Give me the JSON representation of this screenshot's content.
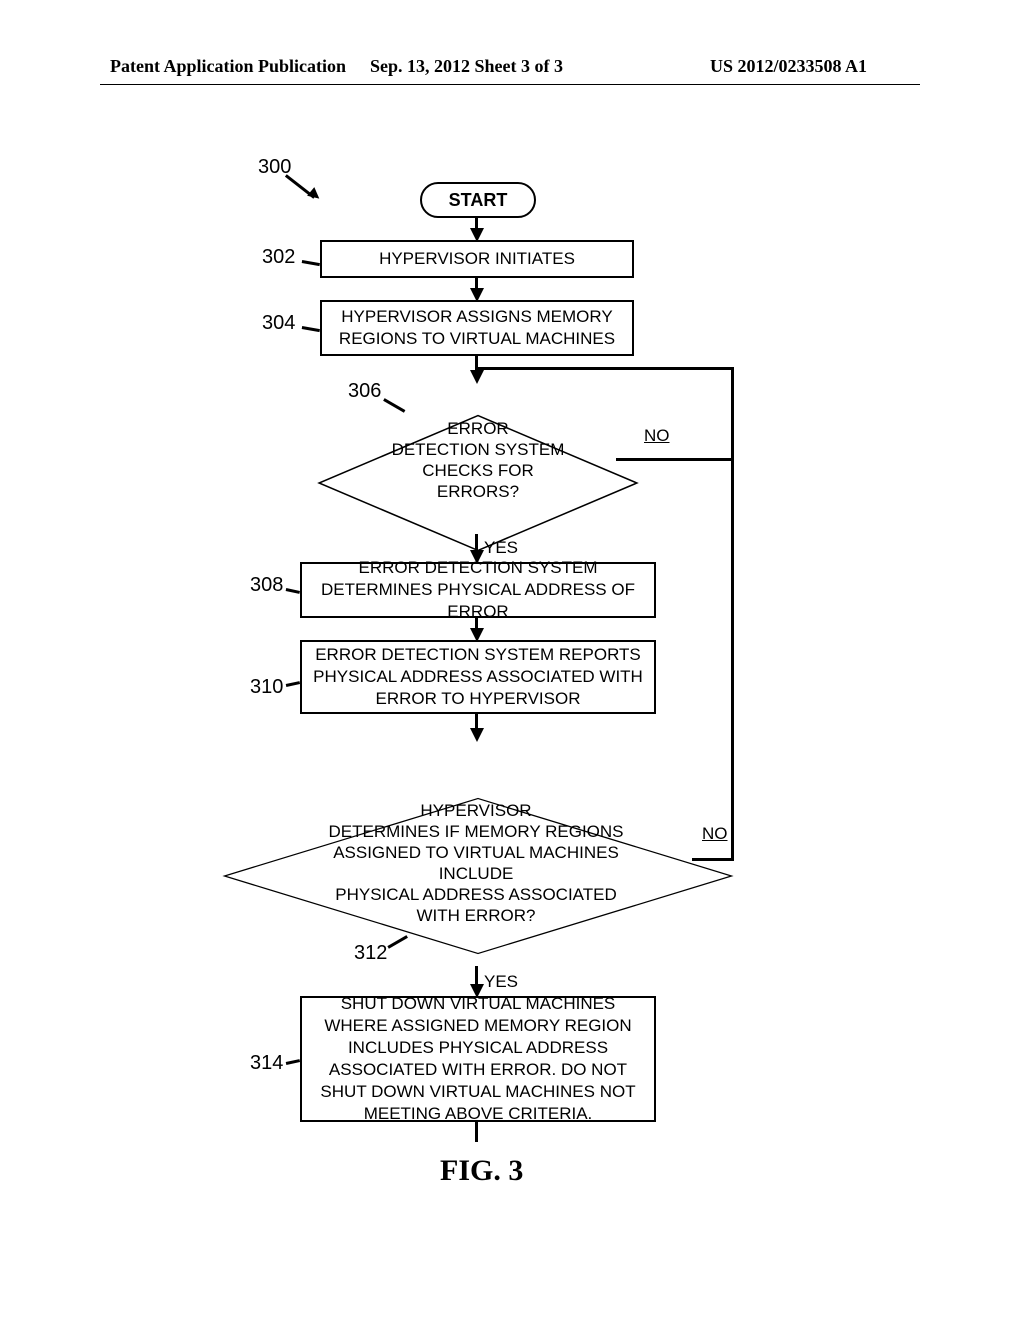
{
  "header": {
    "left": "Patent Application Publication",
    "center": "Sep. 13, 2012  Sheet 3 of 3",
    "right": "US 2012/0233508 A1"
  },
  "diagram": {
    "ref_main": "300",
    "start": "START",
    "step302": {
      "ref": "302",
      "text": "HYPERVISOR INITIATES"
    },
    "step304": {
      "ref": "304",
      "text": "HYPERVISOR ASSIGNS MEMORY REGIONS TO VIRTUAL MACHINES"
    },
    "dec306": {
      "ref": "306",
      "text": "ERROR\nDETECTION SYSTEM\nCHECKS FOR\nERRORS?",
      "yes": "YES",
      "no": "NO"
    },
    "step308": {
      "ref": "308",
      "text": "ERROR DETECTION SYSTEM DETERMINES PHYSICAL ADDRESS OF ERROR"
    },
    "step310": {
      "ref": "310",
      "text": "ERROR DETECTION SYSTEM REPORTS PHYSICAL ADDRESS ASSOCIATED WITH ERROR TO HYPERVISOR"
    },
    "dec312": {
      "ref": "312",
      "text": "HYPERVISOR\nDETERMINES IF MEMORY REGIONS\nASSIGNED TO VIRTUAL MACHINES INCLUDE\nPHYSICAL ADDRESS ASSOCIATED\nWITH ERROR?",
      "yes": "YES",
      "no": "NO"
    },
    "step314": {
      "ref": "314",
      "text": "SHUT DOWN VIRTUAL MACHINES WHERE ASSIGNED MEMORY REGION INCLUDES PHYSICAL ADDRESS ASSOCIATED WITH ERROR. DO NOT SHUT DOWN VIRTUAL MACHINES NOT MEETING ABOVE CRITERIA."
    },
    "figure": "FIG. 3"
  }
}
